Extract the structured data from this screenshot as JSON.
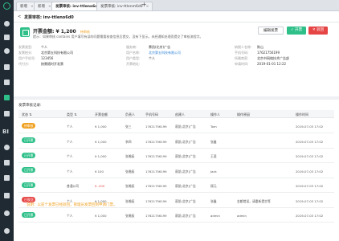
{
  "sidebar": {
    "bi_label": "BI"
  },
  "tabs": [
    {
      "label": "新增",
      "close": "×"
    },
    {
      "label": "新增",
      "close": "×"
    },
    {
      "label": "发票审核: inv-ttleno6d0",
      "close": "×"
    },
    {
      "label": "发票审核: inv-ttlenm6d0",
      "close": "×"
    }
  ],
  "tab_add": "+",
  "header": {
    "back": "<",
    "breadcrumb": "发票审核: inv-ttleno6d0",
    "amount_title": "开票金额: ¥ 1,200",
    "status_tag": "待审核",
    "notice": "提示：如果审核 contains 用户填写有误的问题需要核查信息后提交，没有下显示。未经通知处理而提交了审核流程字。",
    "buttons": {
      "edit": "编辑发票",
      "approve": "✓ 开票",
      "reject": "✕ 驳回"
    }
  },
  "fields": [
    {
      "k": "发票类型:",
      "v": "个人",
      "blue": false
    },
    {
      "k": "发票抬头:",
      "v": "北京第五科技有限公司",
      "blue": false
    },
    {
      "k": "用户手机号:",
      "v": "123456",
      "blue": false
    },
    {
      "k": "代付方:",
      "v": "按需随时开发票",
      "blue": false
    },
    {
      "k": "服务商:",
      "v": "慕凯(北京)广告",
      "blue": false
    },
    {
      "k": "用户名称:",
      "v": "北京第五科技有限公司",
      "blue": true
    },
    {
      "k": "用户类型:",
      "v": "个人",
      "blue": false
    },
    {
      "k": "开票地址:",
      "v": "",
      "blue": false
    },
    {
      "k": "纳税人名称:",
      "v": "陈山",
      "blue": false
    },
    {
      "k": "手机号码:",
      "v": "17621756199",
      "blue": false
    },
    {
      "k": "所属商家:",
      "v": "北京书网络技术广告部",
      "blue": false
    },
    {
      "k": "申请时间:",
      "v": "2019-01-01 12:22",
      "blue": false
    }
  ],
  "records": {
    "title": "发票审核记录:",
    "columns": [
      "状态 ⇅",
      "类型 ⇅",
      "开票金额",
      "负责人",
      "手机号码",
      "创建人",
      "操作人",
      "操作原因",
      "操作时间"
    ],
    "rows": [
      {
        "status": "待审核",
        "color": "#f0a020",
        "type": "个人",
        "amount": "¥ 1,000",
        "neg": false,
        "owner": "张三",
        "phone": "17621756199",
        "creator": "慕凯(北京)广告",
        "operator": "Tom",
        "reason": "",
        "time": "2019-07-03 17:02"
      },
      {
        "status": "已开票",
        "color": "#2fc08a",
        "type": "个人",
        "amount": "¥ 1,000",
        "neg": false,
        "owner": "李四",
        "phone": "17621756199",
        "creator": "慕凯(北京)广告",
        "operator": "张鑫",
        "reason": "",
        "time": "2019-07-03 17:02"
      },
      {
        "status": "已开票",
        "color": "#2fc08a",
        "type": "个人",
        "amount": "¥ 1,000",
        "neg": false,
        "owner": "张瀚辰",
        "phone": "17621756199",
        "creator": "慕凯(北京)广告",
        "operator": "王斐",
        "reason": "",
        "time": "2019-07-03 17:02"
      },
      {
        "status": "已开票",
        "color": "#2fc08a",
        "type": "个人",
        "amount": "¥ 100",
        "neg": false,
        "owner": "张瀚辰",
        "phone": "17621756199",
        "creator": "慕凯(北京)广告",
        "operator": "Jack",
        "reason": "",
        "time": "2019-07-03 17:02"
      },
      {
        "status": "已开票",
        "color": "#2fc08a",
        "type": "普通公司",
        "amount": "¥ -200",
        "neg": true,
        "owner": "张瀚辰",
        "phone": "17621756199",
        "creator": "慕凯(北京)广告",
        "operator": "顾元",
        "reason": "",
        "time": "2019-07-03 17:02"
      },
      {
        "status": "已驳回",
        "color": "#e64545",
        "type": "个人",
        "amount": "¥ 1,000",
        "neg": false,
        "owner": "张瀚辰",
        "phone": "17621756199",
        "creator": "慕凯(北京)广告",
        "operator": "张鑫",
        "reason": "金额错误，请重新提交等",
        "time": "2019-07-03 17:02"
      },
      {
        "status": "已开票",
        "color": "#2fc08a",
        "type": "个人",
        "amount": "¥ 1,000",
        "neg": false,
        "owner": "张瀚辰",
        "phone": "17621756199",
        "creator": "慕凯(北京)广告",
        "operator": "admin",
        "reason": "admin",
        "time": "2019-07-03 17:02"
      }
    ]
  },
  "footer_note": "说明：以前个发票已经驳回，管理员发票回到申请门票。"
}
